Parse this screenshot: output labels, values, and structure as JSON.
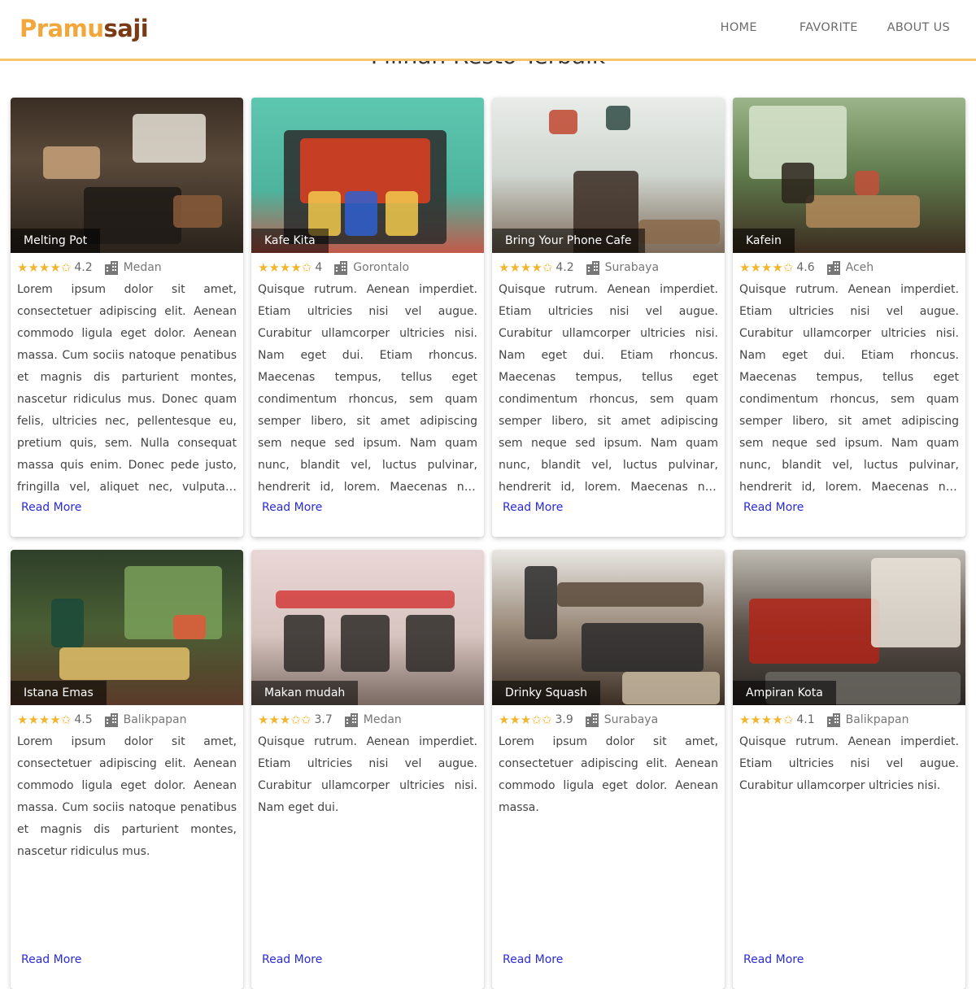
{
  "brand": {
    "part1": "Pramu",
    "part2": "saji"
  },
  "nav": {
    "home": "HOME",
    "favorite": "FAVORITE",
    "about": "ABOUT US"
  },
  "section_title": "Pilihan Resto Terbaik",
  "read_more_label": "Read More",
  "colors": {
    "accent": "#f5c56d",
    "star": "#f1b530",
    "link": "#2b2bd6"
  },
  "restaurants": [
    {
      "name": "Melting Pot",
      "stars": "★★★★✩",
      "rating": "4.2",
      "city": "Medan",
      "desc": "Lorem ipsum dolor sit amet, consectetuer adipiscing elit. Aenean commodo ligula eget dolor. Aenean massa. Cum sociis natoque penatibus et magnis dis parturient montes, nascetur ridiculus mus. Donec quam felis, ultricies nec, pellentesque eu, pretium quis, sem. Nulla consequat massa quis enim. Donec pede justo, fringilla vel, aliquet nec, vulputate eget, arcu. In enim justo, rhoncus ut, imperdiet a, venenatis vitae, justo."
    },
    {
      "name": "Kafe Kita",
      "stars": "★★★★✩",
      "rating": "4",
      "city": "Gorontalo",
      "desc": "Quisque rutrum. Aenean imperdiet. Etiam ultricies nisi vel augue. Curabitur ullamcorper ultricies nisi. Nam eget dui. Etiam rhoncus. Maecenas tempus, tellus eget condimentum rhoncus, sem quam semper libero, sit amet adipiscing sem neque sed ipsum. Nam quam nunc, blandit vel, luctus pulvinar, hendrerit id, lorem. Maecenas nec odio et ante tincidunt tempus. Donec vitae sapien ut libero venenatis faucibus."
    },
    {
      "name": "Bring Your Phone Cafe",
      "stars": "★★★★✩",
      "rating": "4.2",
      "city": "Surabaya",
      "desc": "Quisque rutrum. Aenean imperdiet. Etiam ultricies nisi vel augue. Curabitur ullamcorper ultricies nisi. Nam eget dui. Etiam rhoncus. Maecenas tempus, tellus eget condimentum rhoncus, sem quam semper libero, sit amet adipiscing sem neque sed ipsum. Nam quam nunc, blandit vel, luctus pulvinar, hendrerit id, lorem. Maecenas nec odio et ante tincidunt tempus. Donec vitae sapien ut libero venenatis faucibus."
    },
    {
      "name": "Kafein",
      "stars": "★★★★✩",
      "rating": "4.6",
      "city": "Aceh",
      "desc": "Quisque rutrum. Aenean imperdiet. Etiam ultricies nisi vel augue. Curabitur ullamcorper ultricies nisi. Nam eget dui. Etiam rhoncus. Maecenas tempus, tellus eget condimentum rhoncus, sem quam semper libero, sit amet adipiscing sem neque sed ipsum. Nam quam nunc, blandit vel, luctus pulvinar, hendrerit id, lorem. Maecenas nec odio et ante tincidunt tempus. Donec vitae sapien ut libero venenatis faucibus."
    },
    {
      "name": "Istana Emas",
      "stars": "★★★★✩",
      "rating": "4.5",
      "city": "Balikpapan",
      "desc": "Lorem ipsum dolor sit amet, consectetuer adipiscing elit. Aenean commodo ligula eget dolor. Aenean massa. Cum sociis natoque penatibus et magnis dis parturient montes, nascetur ridiculus mus."
    },
    {
      "name": "Makan mudah",
      "stars": "★★★✩✩",
      "rating": "3.7",
      "city": "Medan",
      "desc": "Quisque rutrum. Aenean imperdiet. Etiam ultricies nisi vel augue. Curabitur ullamcorper ultricies nisi. Nam eget dui."
    },
    {
      "name": "Drinky Squash",
      "stars": "★★★✩✩",
      "rating": "3.9",
      "city": "Surabaya",
      "desc": "Lorem ipsum dolor sit amet, consectetuer adipiscing elit. Aenean commodo ligula eget dolor. Aenean massa."
    },
    {
      "name": "Ampiran Kota",
      "stars": "★★★★✩",
      "rating": "4.1",
      "city": "Balikpapan",
      "desc": "Quisque rutrum. Aenean imperdiet. Etiam ultricies nisi vel augue. Curabitur ullamcorper ultricies nisi."
    }
  ]
}
